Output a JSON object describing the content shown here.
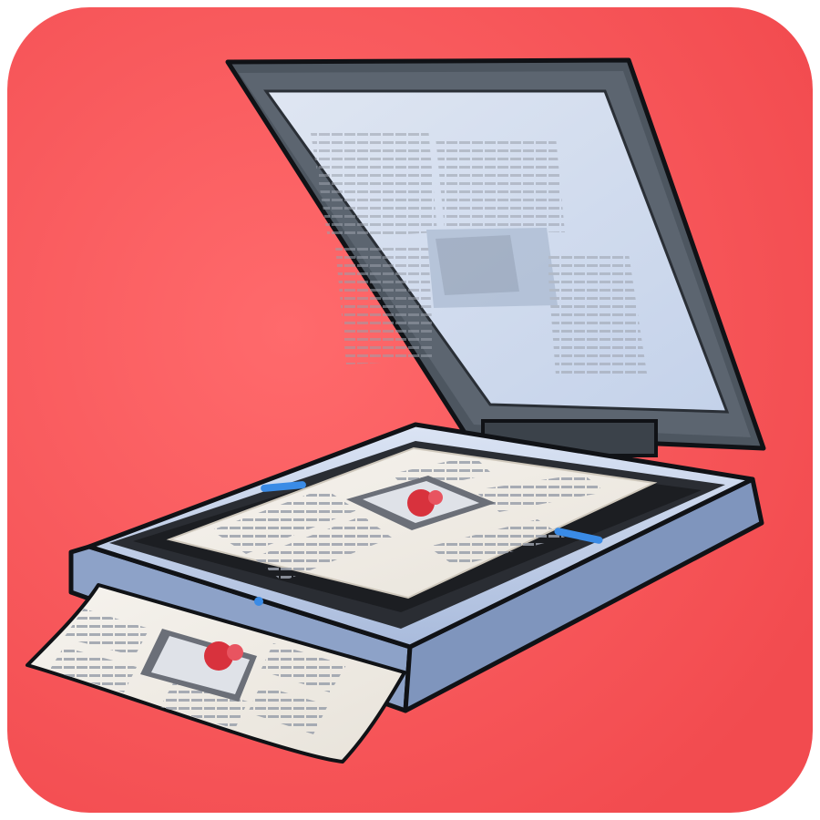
{
  "icon": {
    "subject": "flatbed-scanner-icon",
    "colors": {
      "background": "#f24b4f",
      "background_glow": "#ff6a6c",
      "lid_frame": "#4d5660",
      "lid_glass": "#c9d6ea",
      "base_body": "#c4d2ea",
      "base_edge": "#7f95bd",
      "bed_frame": "#2a2d33",
      "paper": "#f3efe8",
      "text_lines": "#8a8f9a",
      "photo_accent": "#d8323d",
      "indicator": "#3a8be6",
      "outline": "#101216"
    }
  }
}
